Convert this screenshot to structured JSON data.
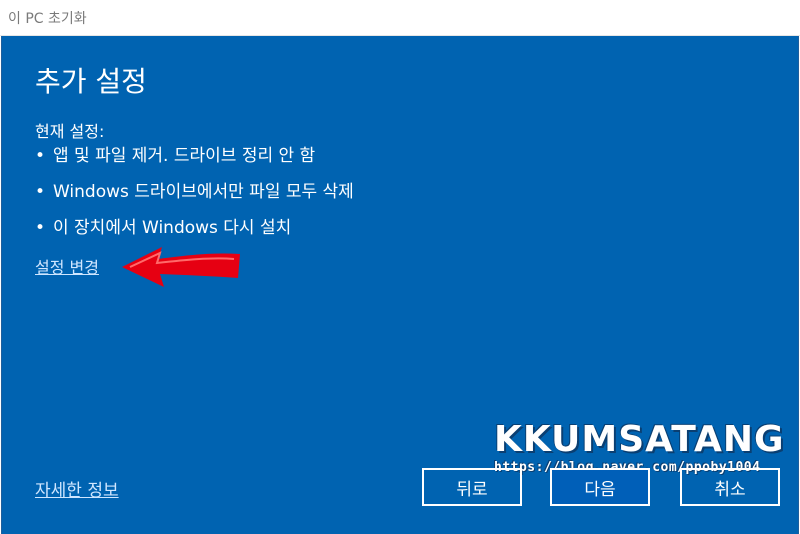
{
  "window": {
    "title": "이 PC 초기화"
  },
  "main": {
    "heading": "추가 설정",
    "current_label": "현재 설정:",
    "bullets": [
      "앱 및 파일 제거. 드라이브 정리 안 함",
      "Windows 드라이브에서만 파일 모두 삭제",
      "이 장치에서 Windows 다시 설치"
    ],
    "bullet_char": "•",
    "change_settings_link": "설정 변경",
    "more_info_link": "자세한 정보"
  },
  "watermark": {
    "title": "KKUMSATANG",
    "url": "https://blog.naver.com/ppoby1004"
  },
  "buttons": {
    "back": "뒤로",
    "next": "다음",
    "cancel": "취소"
  },
  "colors": {
    "panel": "#0063b1",
    "arrow": "#e60012",
    "text": "#ffffff"
  }
}
